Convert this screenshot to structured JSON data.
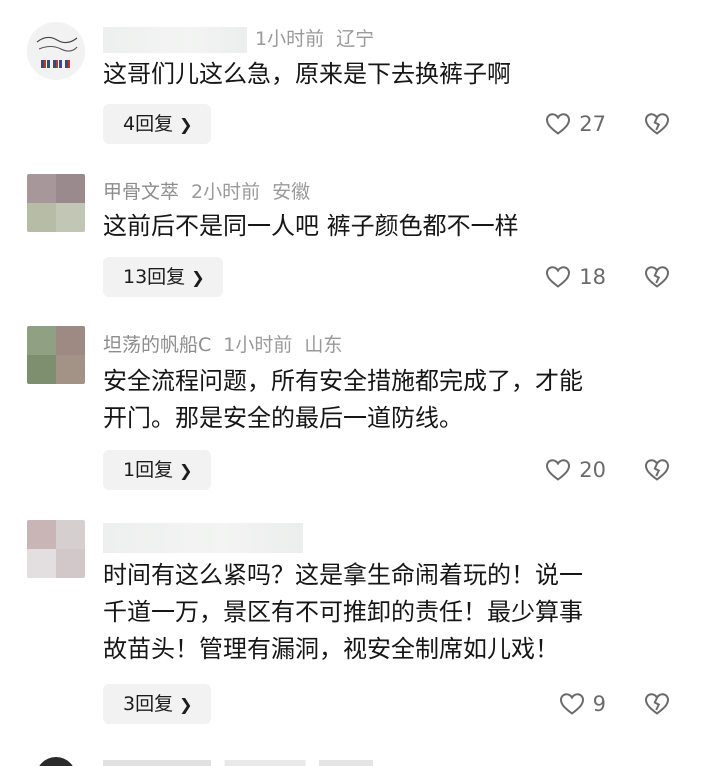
{
  "comments": [
    {
      "name": "",
      "time": "1小时前",
      "location": "辽宁",
      "lines": [
        "这哥们儿这么急，原来是下去换裤子啊"
      ],
      "replies": "4回复",
      "likes": "27"
    },
    {
      "name": "甲骨文萃",
      "time": "2小时前",
      "location": "安徽",
      "lines": [
        "这前后不是同一人吧 裤子颜色都不一样"
      ],
      "replies": "13回复",
      "likes": "18"
    },
    {
      "name": "坦荡的帆船C",
      "time": "1小时前",
      "location": "山东",
      "lines": [
        "安全流程问题，所有安全措施都完成了，才能",
        "开门。那是安全的最后一道防线。"
      ],
      "replies": "1回复",
      "likes": "20"
    },
    {
      "name": "",
      "time": "",
      "location": "",
      "lines": [
        "时间有这么紧吗？这是拿生命闹着玩的！说一",
        "千道一万，景区有不可推卸的责任！最少算事",
        "故苗头！管理有漏洞，视安全制席如儿戏！"
      ],
      "replies": "3回复",
      "likes": "9"
    }
  ],
  "icons": {
    "like": "heart-outline-icon",
    "dislike": "broken-heart-icon",
    "reply_chevron": "chevron-right-icon"
  },
  "colors": {
    "meta": "#9a9a9a",
    "text": "#161616",
    "reply_bg": "#f2f2f2",
    "icon": "#6b6b6b"
  }
}
